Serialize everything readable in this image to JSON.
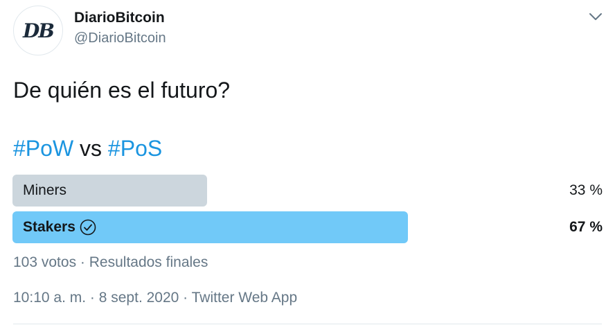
{
  "author": {
    "display_name": "DiarioBitcoin",
    "handle": "@DiarioBitcoin",
    "avatar_text": "DB",
    "avatar_icon": "diariobitcoin-logo"
  },
  "menu_icon": "chevron-down-icon",
  "tweet": {
    "line1": "De quién es el futuro?",
    "hashtag1": "#PoW",
    "connector": " vs ",
    "hashtag2": "#PoS"
  },
  "poll": {
    "options": [
      {
        "label": "Miners",
        "percent_text": "33 %",
        "percent": 33,
        "winner": false
      },
      {
        "label": "Stakers",
        "percent_text": "67 %",
        "percent": 67,
        "winner": true
      }
    ],
    "votes": "103 votos",
    "separator": " · ",
    "status": "Resultados finales"
  },
  "meta": {
    "time": "10:10 a. m.",
    "date": "8 sept. 2020",
    "source": "Twitter Web App",
    "separator": " · "
  },
  "colors": {
    "hashtag": "#1b95e0",
    "bar_winner": "#71c9f8",
    "bar_loser": "#ccd6dd",
    "secondary_text": "#657786"
  }
}
